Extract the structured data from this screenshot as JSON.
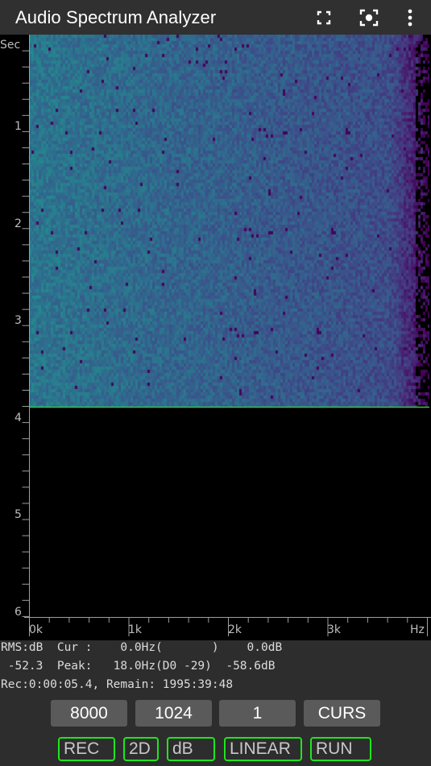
{
  "app_bar": {
    "title": "Audio Spectrum Analyzer",
    "icons": [
      "fullscreen-icon",
      "screenshot-icon",
      "more-vert-icon"
    ]
  },
  "plot": {
    "y_axis_unit": "Sec",
    "y_ticks": [
      "1",
      "2",
      "3",
      "4",
      "5",
      "6"
    ],
    "x_axis_unit": "Hz",
    "x_ticks": [
      "0k",
      "1k",
      "2k",
      "3k"
    ],
    "time_range_sec": [
      0,
      6
    ],
    "freq_range_hz": [
      0,
      4000
    ],
    "recorded_until_sec": 3.85,
    "colormap": [
      "#23898e",
      "#2c728e",
      "#3b528b",
      "#472d7b",
      "#440154",
      "#000000"
    ],
    "cursor_line_color": "#2ecc40"
  },
  "info": {
    "line1": "RMS:dB  Cur :    0.0Hz(       )    0.0dB",
    "line2": " -52.3  Peak:   18.0Hz(D0 -29)  -58.6dB",
    "line3": "Rec:0:00:05.4, Remain: 1995:39:48"
  },
  "controls": {
    "sample_rate": "8000",
    "fft_size": "1024",
    "average": "1",
    "cursor": "CURS"
  },
  "toggles": {
    "rec": "REC",
    "view": "2D",
    "scale": "dB",
    "freq_axis": "LINEAR",
    "run": "RUN"
  }
}
